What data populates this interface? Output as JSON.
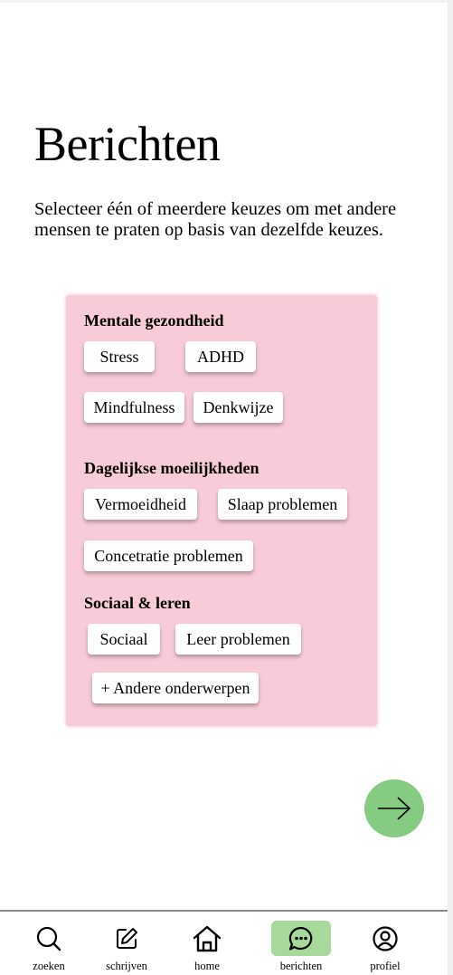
{
  "page": {
    "title": "Berichten",
    "intro": "Selecteer één of meerdere keuzes om met andere mensen te praten op basis van dezelfde keuzes."
  },
  "sections": [
    {
      "title": "Mentale gezondheid",
      "chips": [
        "Stress",
        "ADHD",
        "Mindfulness",
        "Denkwijze"
      ]
    },
    {
      "title": "Dagelijkse moeilijkheden",
      "chips": [
        "Vermoeidheid",
        "Slaap problemen",
        "Concetratie problemen"
      ]
    },
    {
      "title": "Sociaal & leren",
      "chips": [
        "Sociaal",
        "Leer problemen",
        "+ Andere onderwerpen"
      ]
    }
  ],
  "next_button": {
    "icon": "arrow-right-icon",
    "color": "#85cb82"
  },
  "panel_color": "#f8cbd8",
  "nav": {
    "active_color": "#a7d99b",
    "items": [
      {
        "label": "zoeken",
        "icon": "search-icon"
      },
      {
        "label": "schrijven",
        "icon": "edit-icon"
      },
      {
        "label": "home",
        "icon": "home-icon"
      },
      {
        "label": "berichten",
        "icon": "chat-icon",
        "active": true
      },
      {
        "label": "profiel",
        "icon": "profile-icon"
      }
    ]
  }
}
